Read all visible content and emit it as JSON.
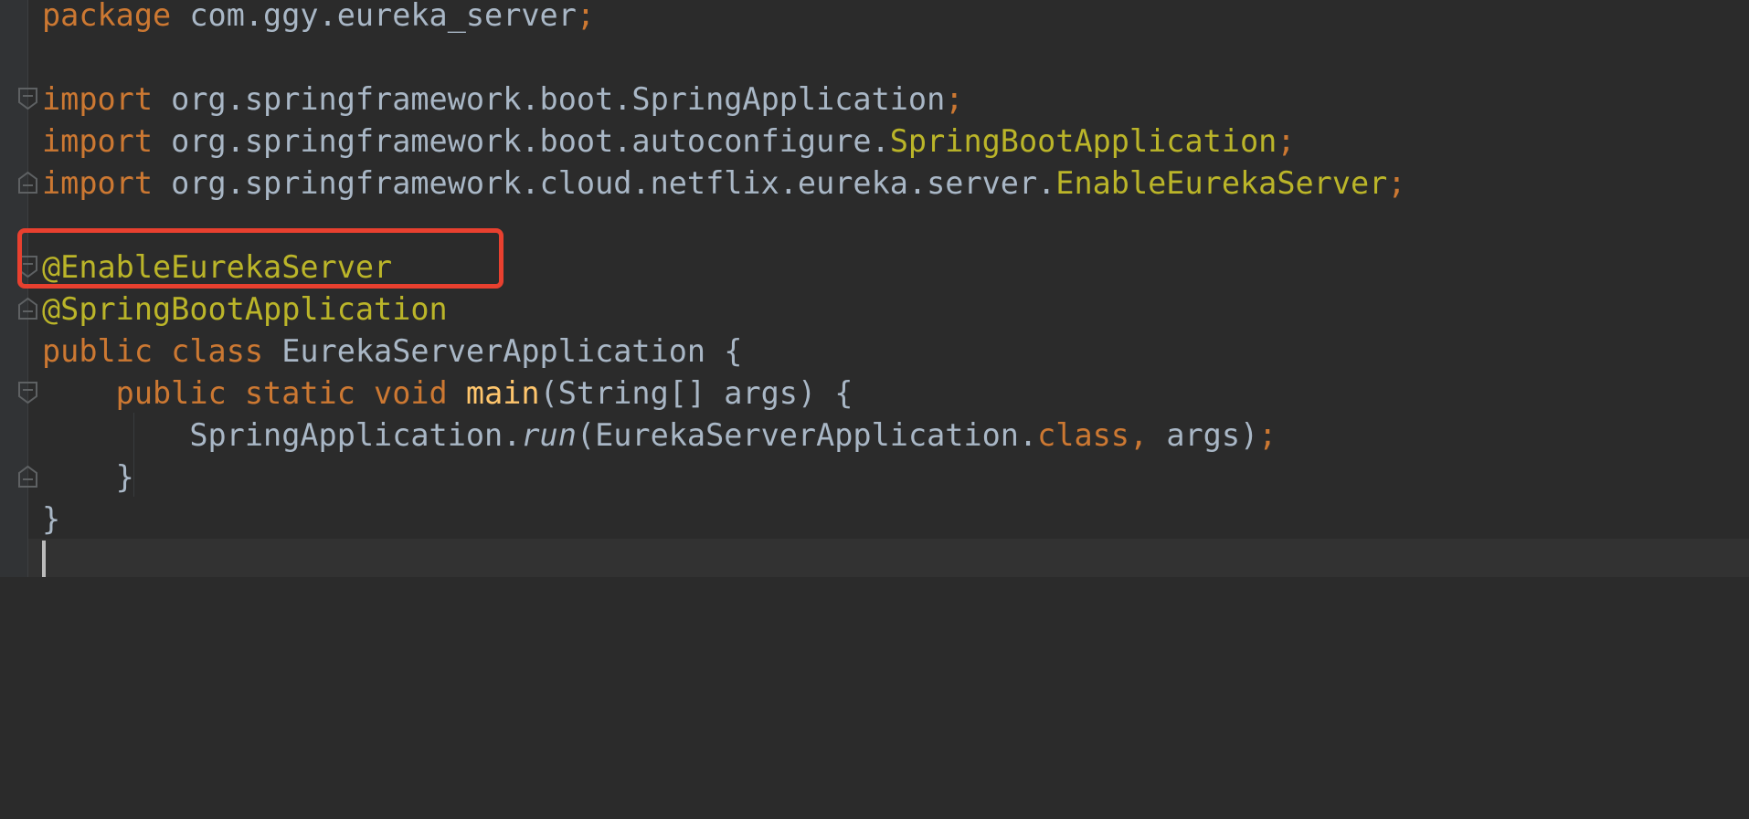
{
  "code": {
    "lines": [
      {
        "t1": "package",
        "t2": " com.ggy.eureka_server",
        "t3": ";"
      },
      {},
      {
        "t1": "import",
        "t2": " org.springframework.boot.SpringApplication",
        "t3": ";"
      },
      {
        "t1": "import",
        "t2": " org.springframework.boot.autoconfigure.",
        "t3": "SpringBootApplication",
        "t4": ";"
      },
      {
        "t1": "import",
        "t2": " org.springframework.cloud.netflix.eureka.server.",
        "t3": "EnableEurekaServer",
        "t4": ";"
      },
      {},
      {
        "t1": "@EnableEurekaServer"
      },
      {
        "t1": "@SpringBootApplication"
      },
      {
        "t1": "public",
        "t2": " ",
        "t3": "class",
        "t4": " EurekaServerApplication {"
      },
      {
        "t1": "    public",
        "t2": " ",
        "t3": "static",
        "t4": " ",
        "t5": "void",
        "t6": " ",
        "t7": "main",
        "t8": "(String[] args) {"
      },
      {
        "t1": "        SpringApplication.",
        "t2": "run",
        "t3": "(EurekaServerApplication.",
        "t4": "class",
        "t5": ", ",
        "t6": "args)",
        "t7": ";"
      },
      {
        "t1": "    }"
      },
      {
        "t1": "}"
      }
    ]
  },
  "colors": {
    "background": "#2b2b2b",
    "keyword": "#cc7832",
    "annotation": "#bbb529",
    "identifier": "#a9b7c6",
    "method": "#ffc66d",
    "highlight_box": "#e8402f"
  }
}
